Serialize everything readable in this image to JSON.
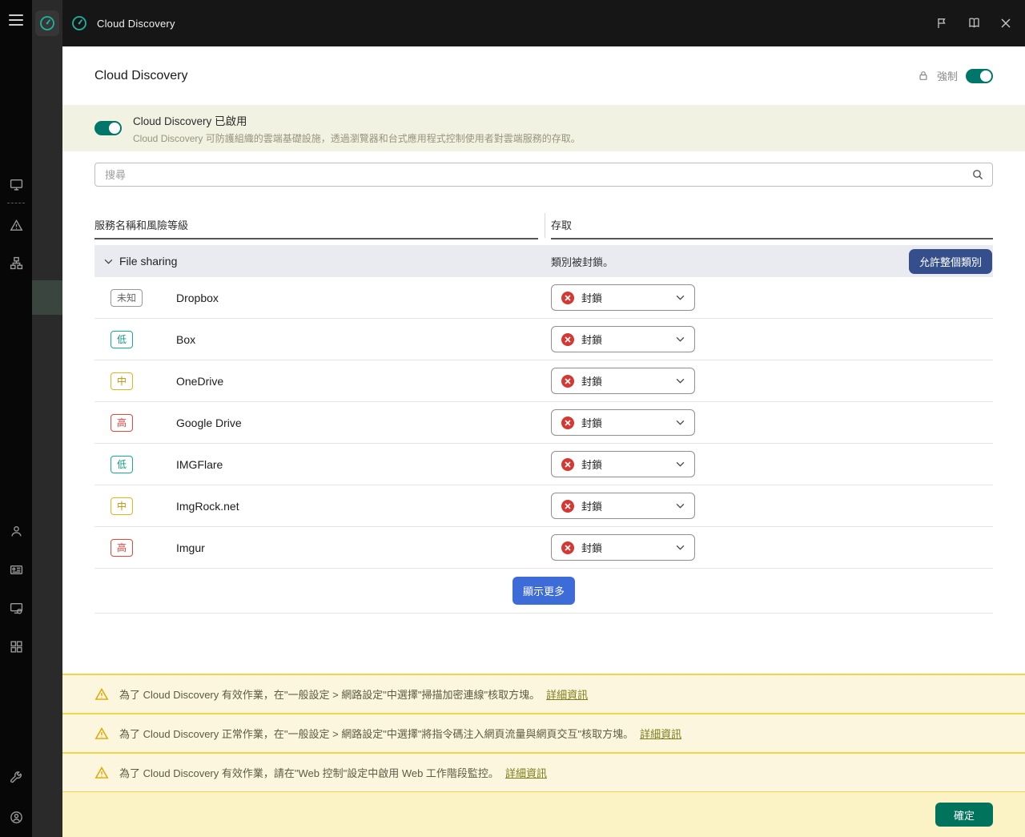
{
  "app": {
    "window_title": "Cloud Discovery"
  },
  "panel": {
    "title": "Cloud Discovery",
    "enforce_label": "強制",
    "enabled": {
      "title": "Cloud Discovery 已啟用",
      "description": "Cloud Discovery 可防護組織的雲端基礎設施，透過瀏覽器和台式應用程式控制使用者對雲端服務的存取。"
    },
    "search_placeholder": "搜尋",
    "table": {
      "columns": {
        "service": "服務名稱和風險等級",
        "access": "存取"
      },
      "group": {
        "name": "File sharing",
        "status": "類別被封鎖。",
        "allow_button": "允許整個類別"
      },
      "rows": [
        {
          "risk_label": "未知",
          "risk": "unknown",
          "name": "Dropbox",
          "access": "封鎖"
        },
        {
          "risk_label": "低",
          "risk": "low",
          "name": "Box",
          "access": "封鎖"
        },
        {
          "risk_label": "中",
          "risk": "medium",
          "name": "OneDrive",
          "access": "封鎖"
        },
        {
          "risk_label": "高",
          "risk": "high",
          "name": "Google Drive",
          "access": "封鎖"
        },
        {
          "risk_label": "低",
          "risk": "low",
          "name": "IMGFlare",
          "access": "封鎖"
        },
        {
          "risk_label": "中",
          "risk": "medium",
          "name": "ImgRock.net",
          "access": "封鎖"
        },
        {
          "risk_label": "高",
          "risk": "high",
          "name": "Imgur",
          "access": "封鎖"
        }
      ]
    },
    "show_more": "顯示更多",
    "warnings": [
      {
        "text": "為了 Cloud Discovery 有效作業，在\"一般設定 > 網路設定\"中選擇\"掃描加密連線\"核取方塊。",
        "link": "詳細資訊"
      },
      {
        "text": "為了 Cloud Discovery 正常作業，在\"一般設定 > 網路設定\"中選擇\"將指令碼注入網頁流量與網頁交互\"核取方塊。",
        "link": "詳細資訊"
      },
      {
        "text": "為了 Cloud Discovery 有效作業，請在\"Web 控制\"設定中啟用 Web 工作階段監控。",
        "link": "詳細資訊"
      }
    ],
    "ok_button": "確定"
  },
  "colors": {
    "accent_teal": "#00a88e",
    "toggle_on": "#00766b",
    "show_more_blue": "#3d6bd8",
    "allow_button_navy": "#344f8c",
    "ok_green": "#00735c",
    "blocked_red": "#d53832",
    "risk_low": "#0e9c82",
    "risk_medium": "#bd9300",
    "risk_high": "#d8423a",
    "warning_amber": "#e0a800",
    "banner_yellow": "#fbf6dd"
  },
  "icons": [
    "hamburger-menu-icon",
    "app-logo-icon",
    "flag-icon",
    "help-book-icon",
    "close-icon",
    "monitor-icon",
    "warning-triangle-icon",
    "hierarchy-icon",
    "user-icon",
    "id-card-icon",
    "device-icon",
    "grid-icon",
    "wrench-icon",
    "support-person-icon",
    "lock-icon",
    "search-icon",
    "chevron-down-icon",
    "blocked-icon"
  ]
}
